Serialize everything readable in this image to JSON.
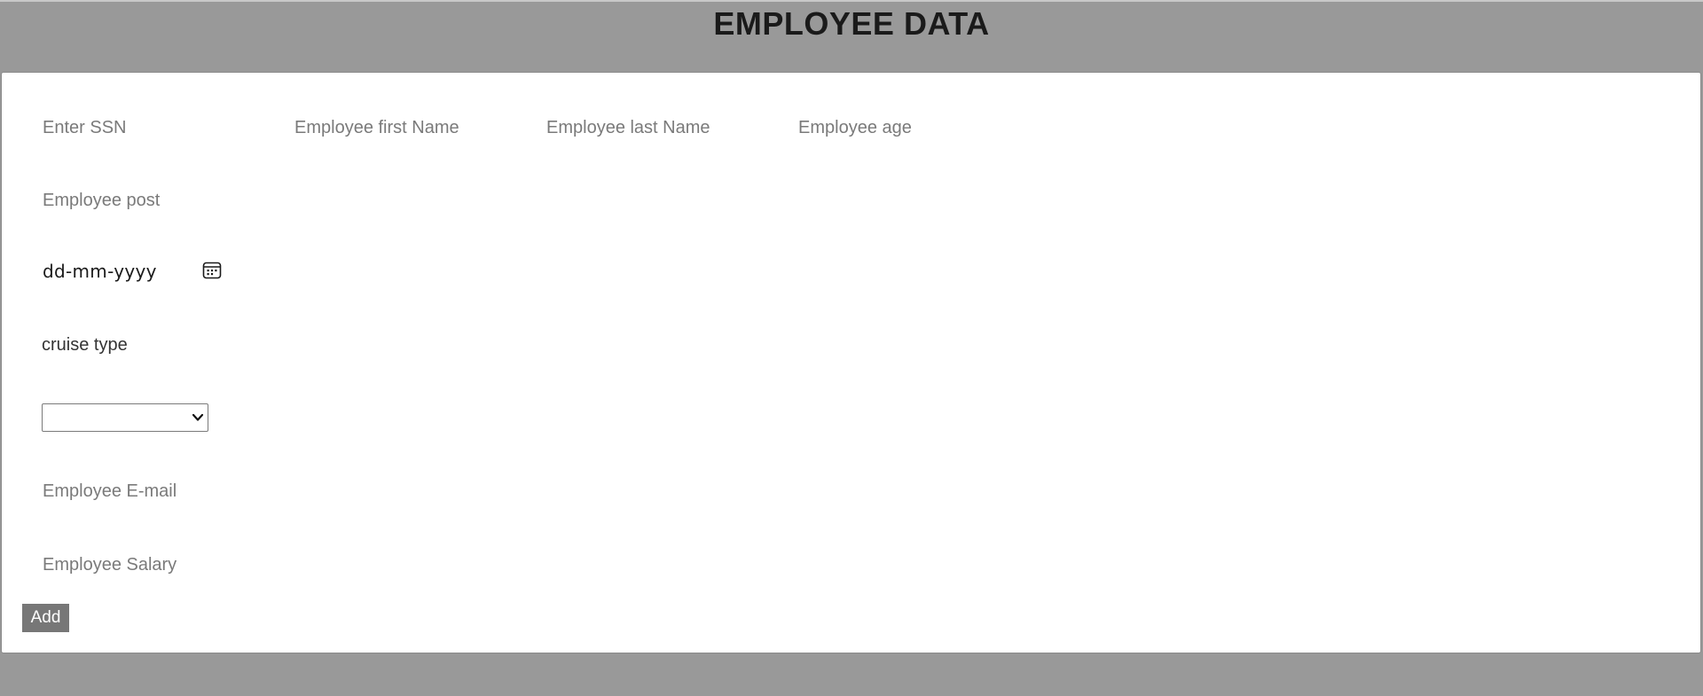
{
  "header": {
    "title": "EMPLOYEE DATA"
  },
  "form": {
    "ssn": {
      "placeholder": "Enter SSN",
      "value": ""
    },
    "first_name": {
      "placeholder": "Employee first Name",
      "value": ""
    },
    "last_name": {
      "placeholder": "Employee last Name",
      "value": ""
    },
    "age": {
      "placeholder": "Employee age",
      "value": ""
    },
    "post": {
      "placeholder": "Employee post",
      "value": ""
    },
    "date": {
      "display": "dd-mm-yyyy",
      "icon": "calendar-icon"
    },
    "cruise_type": {
      "label": "cruise type",
      "selected": "",
      "icon": "chevron-down-icon"
    },
    "email": {
      "placeholder": "Employee E-mail",
      "value": ""
    },
    "salary": {
      "placeholder": "Employee Salary",
      "value": ""
    },
    "add_label": "Add"
  },
  "colors": {
    "page_background": "#999999",
    "card_background": "#ffffff",
    "button_background": "#777777",
    "button_text": "#ffffff",
    "placeholder_text": "#7a7a7a"
  }
}
